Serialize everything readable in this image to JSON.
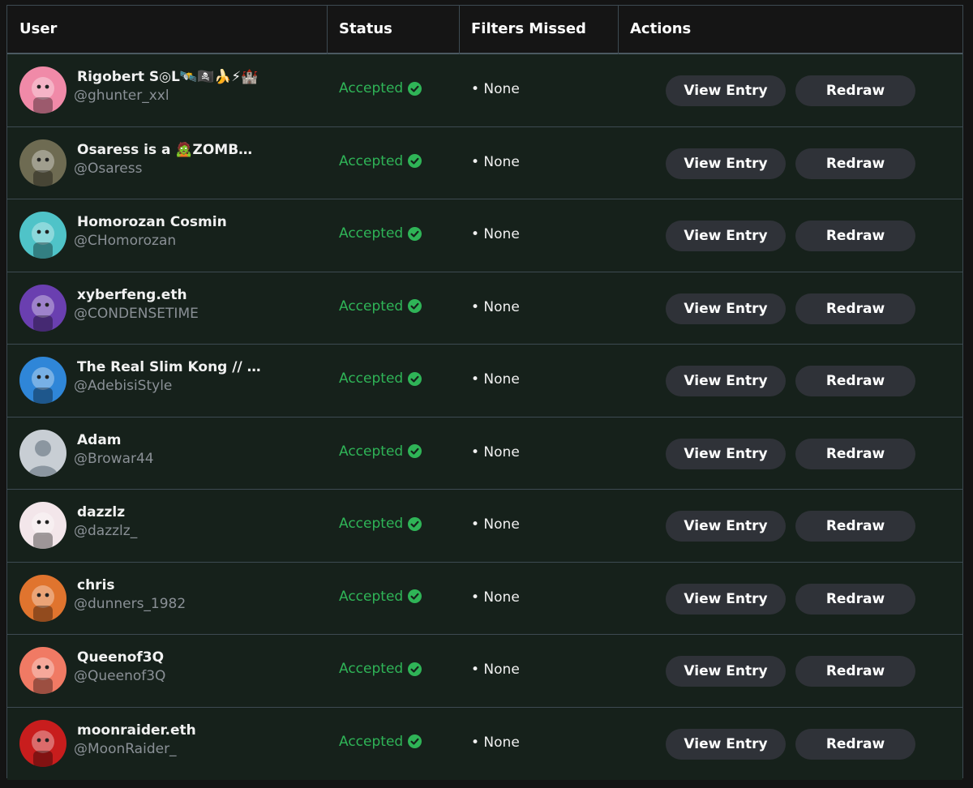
{
  "table": {
    "headers": {
      "user": "User",
      "status": "Status",
      "filters": "Filters Missed",
      "actions": "Actions"
    },
    "rows": [
      {
        "name": "Rigobert S◎L🛰️🏴‍☠️🍌⚡🏰",
        "handle": "@ghunter_xxl",
        "status": "Accepted",
        "filters": "• None",
        "view": "View Entry",
        "redraw": "Redraw",
        "avatar_color": "#f08aa8"
      },
      {
        "name": "Osaress is a 🧟ZOMB…",
        "handle": "@Osaress",
        "status": "Accepted",
        "filters": "• None",
        "view": "View Entry",
        "redraw": "Redraw",
        "avatar_color": "#6e6b52"
      },
      {
        "name": "Homorozan Cosmin",
        "handle": "@CHomorozan",
        "status": "Accepted",
        "filters": "• None",
        "view": "View Entry",
        "redraw": "Redraw",
        "avatar_color": "#4fc3c8"
      },
      {
        "name": "xyberfeng.eth",
        "handle": "@CONDENSETIME",
        "status": "Accepted",
        "filters": "• None",
        "view": "View Entry",
        "redraw": "Redraw",
        "avatar_color": "#6a3fb0"
      },
      {
        "name": "The Real Slim Kong // …",
        "handle": "@AdebisiStyle",
        "status": "Accepted",
        "filters": "• None",
        "view": "View Entry",
        "redraw": "Redraw",
        "avatar_color": "#2f86d8"
      },
      {
        "name": "Adam",
        "handle": "@Browar44",
        "status": "Accepted",
        "filters": "• None",
        "view": "View Entry",
        "redraw": "Redraw",
        "avatar_color": "#c8ced4"
      },
      {
        "name": "dazzlz",
        "handle": "@dazzlz_",
        "status": "Accepted",
        "filters": "• None",
        "view": "View Entry",
        "redraw": "Redraw",
        "avatar_color": "#f3e6ea"
      },
      {
        "name": "chris",
        "handle": "@dunners_1982",
        "status": "Accepted",
        "filters": "• None",
        "view": "View Entry",
        "redraw": "Redraw",
        "avatar_color": "#e0742e"
      },
      {
        "name": "Queenof3Q",
        "handle": "@Queenof3Q",
        "status": "Accepted",
        "filters": "• None",
        "view": "View Entry",
        "redraw": "Redraw",
        "avatar_color": "#f07a64"
      },
      {
        "name": "moonraider.eth",
        "handle": "@MoonRaider_",
        "status": "Accepted",
        "filters": "• None",
        "view": "View Entry",
        "redraw": "Redraw",
        "avatar_color": "#c81d1d"
      }
    ]
  },
  "colors": {
    "accepted": "#2fb457",
    "button_bg": "#2f3238",
    "row_bg": "#16211b",
    "header_bg": "#151515"
  },
  "icons": {
    "status": "check-circle-icon",
    "avatar_placeholder": "default-user-icon"
  }
}
